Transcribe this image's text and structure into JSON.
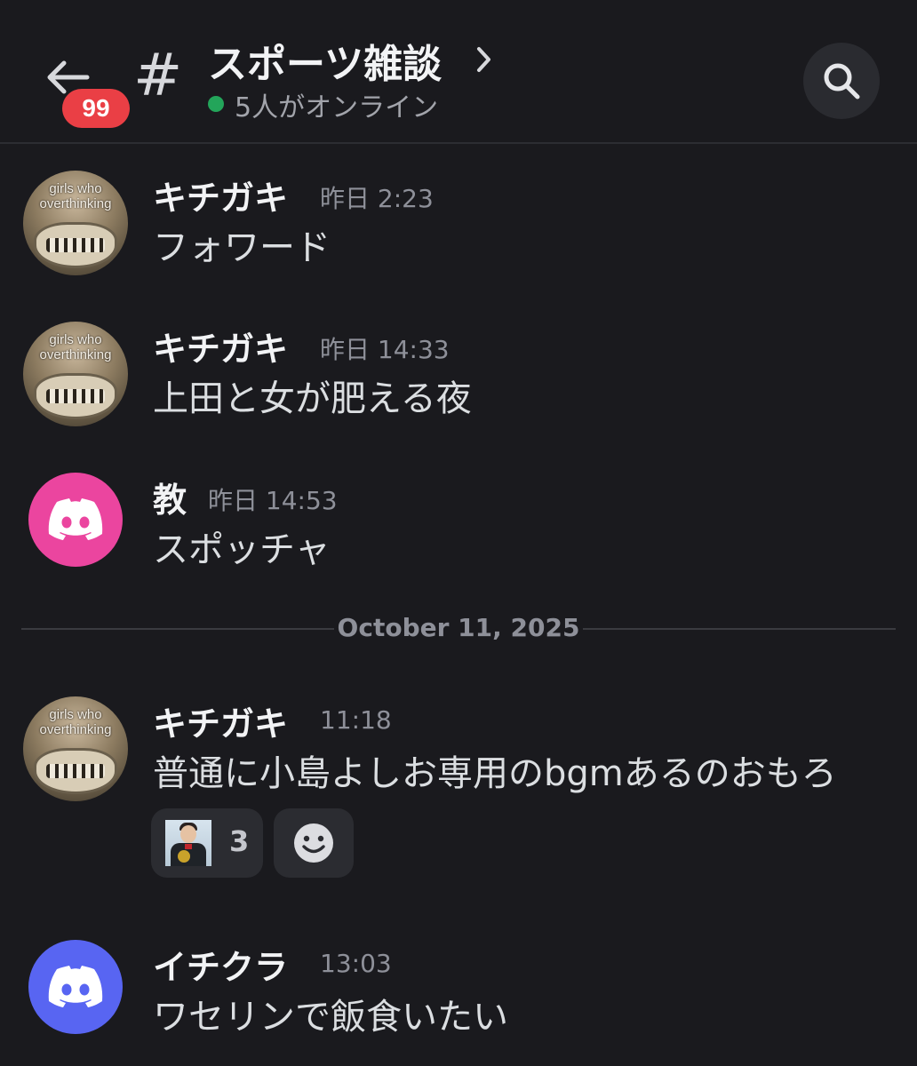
{
  "header": {
    "unread_badge": "99",
    "channel_name": "スポーツ雑談",
    "online_status": "5人がオンライン"
  },
  "messages": [
    {
      "author": "キチガキ",
      "time": "昨日 2:23",
      "text": "フォワード",
      "avatar_caption": "girls who overthinking"
    },
    {
      "author": "キチガキ",
      "time": "昨日 14:33",
      "text": "上田と女が肥える夜",
      "avatar_caption": "girls who overthinking"
    },
    {
      "author": "教",
      "time": "昨日 14:53",
      "text": "スポッチャ",
      "avatar_color": "#eb459f"
    },
    {
      "author": "キチガキ",
      "time": "11:18",
      "text": "普通に小島よしお専用のbgmあるのおもろ",
      "avatar_caption": "girls who overthinking"
    },
    {
      "author": "イチクラ",
      "time": "13:03",
      "text": "ワセリンで飯食いたい",
      "avatar_color": "#5865f2"
    }
  ],
  "date_divider": "October 11, 2025",
  "reactions": [
    {
      "emoji": "custom-photo-emoji",
      "count": "3"
    },
    {
      "emoji": "add-reaction-icon"
    }
  ],
  "colors": {
    "background": "#1a1a1e",
    "badge": "#ea3f45",
    "online": "#23a55a",
    "discord_pink": "#eb459f",
    "discord_blurple": "#5865f2"
  }
}
